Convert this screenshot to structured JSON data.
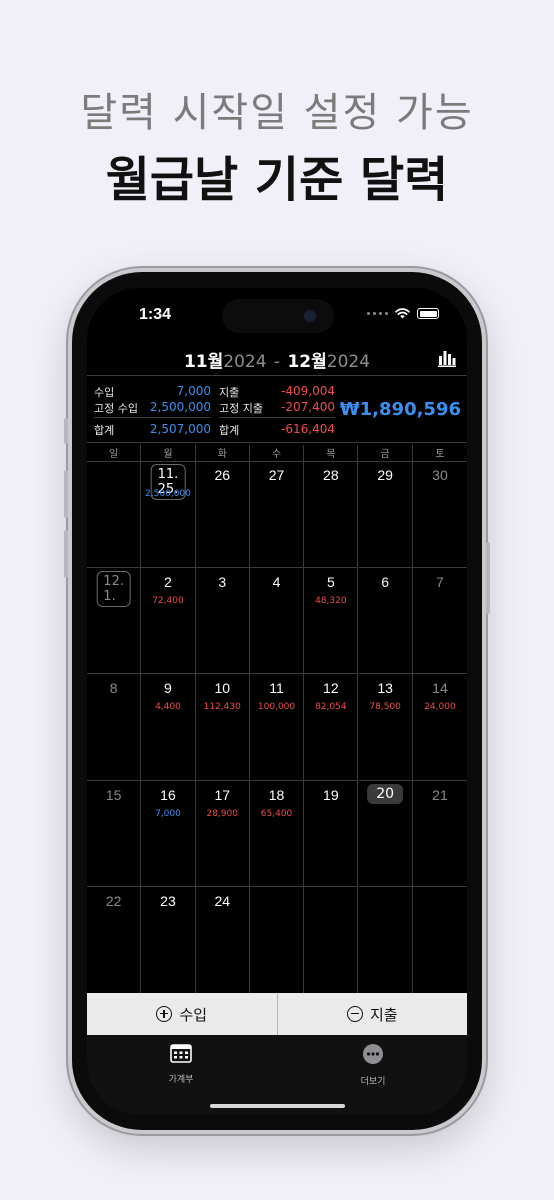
{
  "promo": {
    "subtitle": "달력 시작일 설정 가능",
    "title": "월급날 기준 달력"
  },
  "status": {
    "time": "1:34"
  },
  "header": {
    "start_month": "11월",
    "start_year": "2024",
    "dash": "-",
    "end_month": "12월",
    "end_year": "2024"
  },
  "summary": {
    "income_label": "수입",
    "income_value": "7,000",
    "fixed_income_label": "고정 수입",
    "fixed_income_value": "2,500,000",
    "income_total_label": "합계",
    "income_total_value": "2,507,000",
    "expense_label": "지출",
    "expense_value": "-409,004",
    "fixed_expense_label": "고정 지출",
    "fixed_expense_value": "-207,400",
    "expense_total_label": "합계",
    "expense_total_value": "-616,404",
    "balance": "₩1,890,596"
  },
  "weekdays": [
    "일",
    "월",
    "화",
    "수",
    "목",
    "금",
    "토"
  ],
  "calendar": [
    [
      {
        "day": ""
      },
      {
        "day": "11. 25.",
        "amount": "2,500,000",
        "type": "income",
        "style": "outline"
      },
      {
        "day": "26"
      },
      {
        "day": "27"
      },
      {
        "day": "28"
      },
      {
        "day": "29"
      },
      {
        "day": "30",
        "dim": true
      }
    ],
    [
      {
        "day": "12. 1.",
        "dim": true,
        "style": "outline"
      },
      {
        "day": "2",
        "amount": "72,400",
        "type": "expense"
      },
      {
        "day": "3"
      },
      {
        "day": "4"
      },
      {
        "day": "5",
        "amount": "48,320",
        "type": "expense"
      },
      {
        "day": "6"
      },
      {
        "day": "7",
        "dim": true
      }
    ],
    [
      {
        "day": "8",
        "dim": true
      },
      {
        "day": "9",
        "amount": "4,400",
        "type": "expense"
      },
      {
        "day": "10",
        "amount": "112,430",
        "type": "expense"
      },
      {
        "day": "11",
        "amount": "100,000",
        "type": "expense"
      },
      {
        "day": "12",
        "amount": "82,054",
        "type": "expense"
      },
      {
        "day": "13",
        "amount": "78,500",
        "type": "expense"
      },
      {
        "day": "14",
        "amount": "24,000",
        "type": "expense",
        "dim": true
      }
    ],
    [
      {
        "day": "15",
        "dim": true
      },
      {
        "day": "16",
        "amount": "7,000",
        "type": "income"
      },
      {
        "day": "17",
        "amount": "28,900",
        "type": "expense"
      },
      {
        "day": "18",
        "amount": "65,400",
        "type": "expense"
      },
      {
        "day": "19"
      },
      {
        "day": "20",
        "style": "filled"
      },
      {
        "day": "21",
        "dim": true
      }
    ],
    [
      {
        "day": "22",
        "dim": true
      },
      {
        "day": "23"
      },
      {
        "day": "24"
      },
      {
        "day": ""
      },
      {
        "day": ""
      },
      {
        "day": ""
      },
      {
        "day": ""
      }
    ]
  ],
  "actions": {
    "income": "수입",
    "expense": "지출"
  },
  "tabs": {
    "ledger": "가계부",
    "more": "더보기"
  },
  "colors": {
    "income": "#3b8ff0",
    "expense": "#ee4c4c"
  }
}
